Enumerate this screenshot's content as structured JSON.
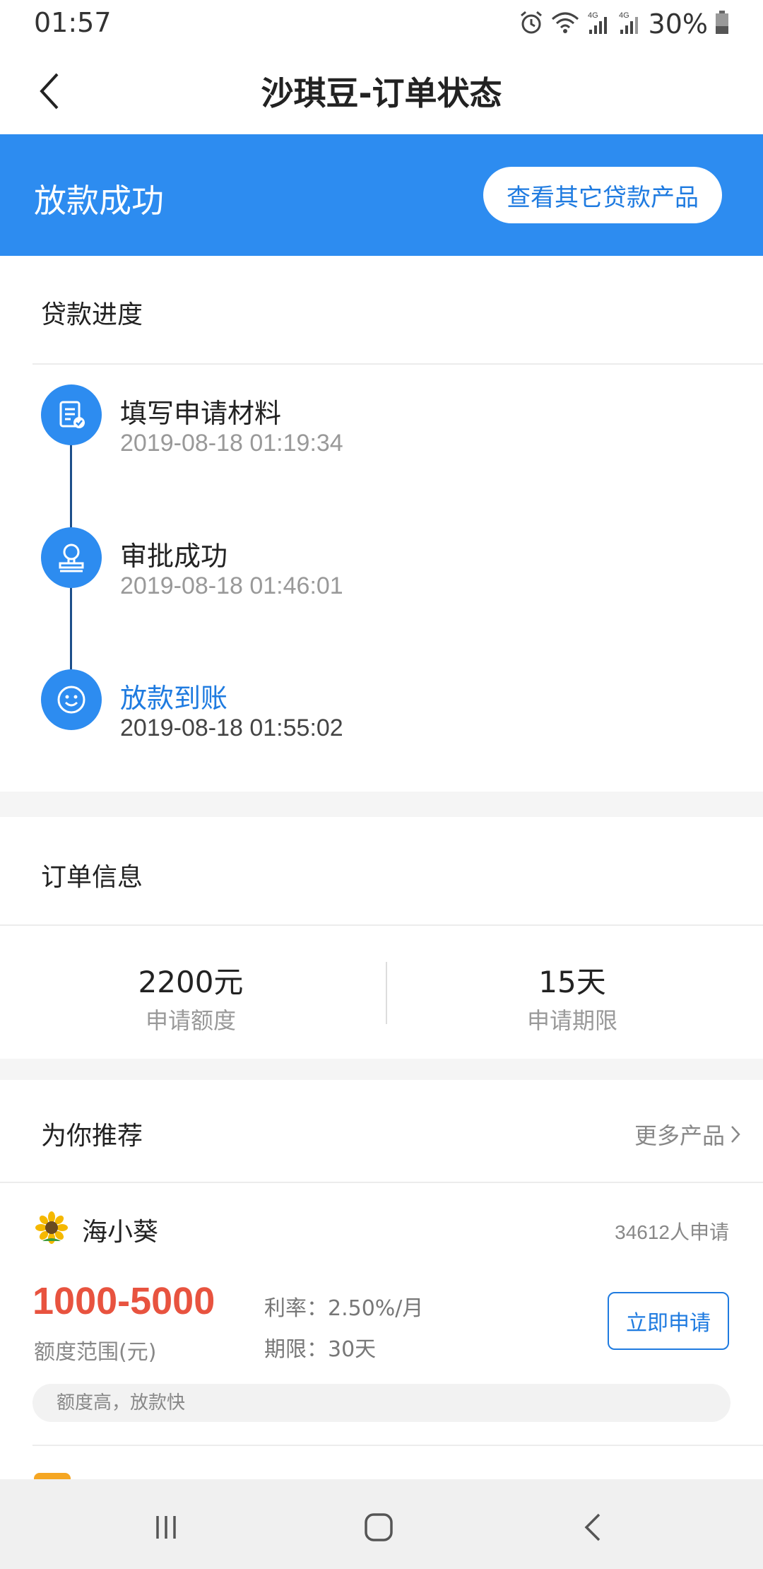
{
  "status_bar": {
    "time": "01:57",
    "battery_text": "30%",
    "icons": [
      "alarm-icon",
      "wifi-icon",
      "signal-4g-icon",
      "signal-4g-icon",
      "battery-icon"
    ]
  },
  "nav": {
    "title": "沙琪豆-订单状态",
    "back_icon": "chevron-left-icon"
  },
  "banner": {
    "status": "放款成功",
    "button_label": "查看其它贷款产品",
    "bg_color": "#2d8cf0"
  },
  "progress": {
    "title": "贷款进度",
    "steps": [
      {
        "title": "填写申请材料",
        "time": "2019-08-18 01:19:34",
        "icon": "document-check-icon",
        "active": false
      },
      {
        "title": "审批成功",
        "time": "2019-08-18 01:46:01",
        "icon": "stamp-icon",
        "active": false
      },
      {
        "title": "放款到账",
        "time": "2019-08-18 01:55:02",
        "icon": "smile-icon",
        "active": true
      }
    ]
  },
  "order": {
    "title": "订单信息",
    "amount_value": "2200元",
    "amount_label": "申请额度",
    "term_value": "15天",
    "term_label": "申请期限"
  },
  "recommend": {
    "title": "为你推荐",
    "more_label": "更多产品",
    "product": {
      "name": "海小葵",
      "logo_icon": "sunflower-icon",
      "applicants": "34612人申请",
      "amount_range": "1000-5000",
      "amount_label": "额度范围(元)",
      "rate": "利率：2.50%/月",
      "term": "期限：30天",
      "apply_label": "立即申请",
      "tag": "额度高，放款快"
    }
  },
  "system_nav": {
    "recent_icon": "recent-apps-icon",
    "home_icon": "home-icon",
    "back_icon": "back-icon"
  },
  "colors": {
    "accent": "#2d8cf0",
    "link": "#1f7be0",
    "highlight_amount": "#e8533f"
  }
}
